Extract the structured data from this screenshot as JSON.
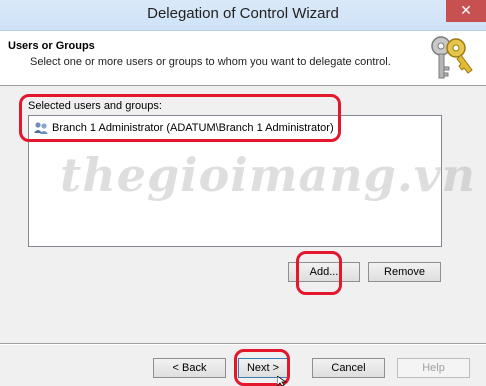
{
  "window": {
    "title": "Delegation of Control Wizard",
    "close_glyph": "✕"
  },
  "header": {
    "title": "Users or Groups",
    "description": "Select one or more users or groups to whom you want to delegate control.",
    "icon": "keys-icon"
  },
  "selection": {
    "label": "Selected users and groups:",
    "items": [
      {
        "label": "Branch 1 Administrator (ADATUM\\Branch 1 Administrator)",
        "icon": "user-group-icon"
      }
    ]
  },
  "buttons": {
    "add": "Add...",
    "remove": "Remove",
    "back": "< Back",
    "next": "Next >",
    "cancel": "Cancel",
    "help": "Help"
  },
  "watermark": "thegioimang.vn",
  "colors": {
    "annotation": "#e3182d",
    "titlebar": "#d9e9f9",
    "close_button": "#c75050"
  }
}
